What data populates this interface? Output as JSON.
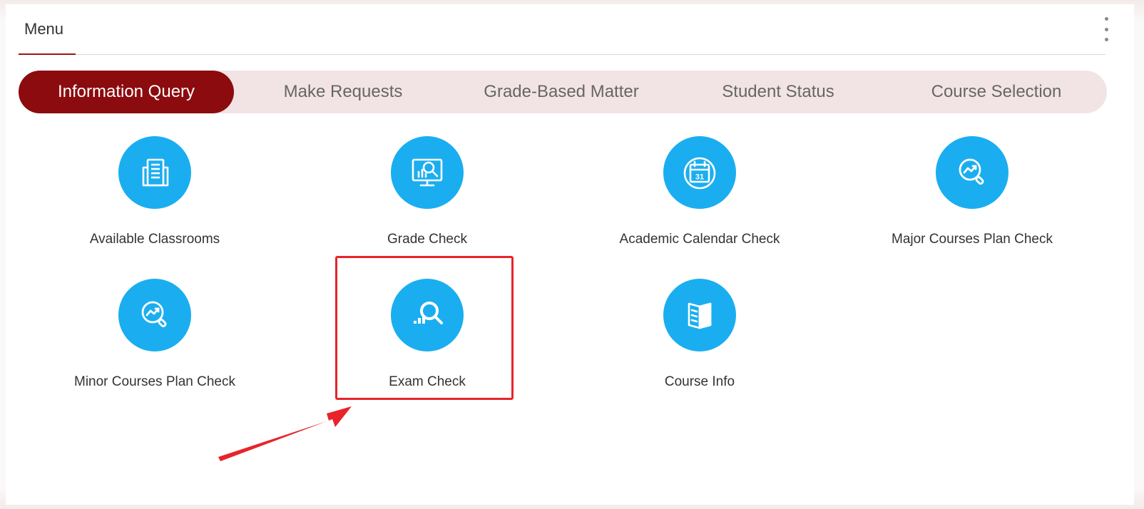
{
  "header": {
    "title": "Menu",
    "more_icon": "more-vertical-icon"
  },
  "tabs": [
    {
      "label": "Information Query",
      "active": true
    },
    {
      "label": "Make Requests",
      "active": false
    },
    {
      "label": "Grade-Based Matter",
      "active": false
    },
    {
      "label": "Student Status",
      "active": false
    },
    {
      "label": "Course Selection",
      "active": false
    }
  ],
  "tiles": [
    {
      "label": "Available Classrooms",
      "icon": "building-icon"
    },
    {
      "label": "Grade Check",
      "icon": "monitor-search-icon"
    },
    {
      "label": "Academic Calendar Check",
      "icon": "calendar-icon"
    },
    {
      "label": "Major Courses Plan Check",
      "icon": "trend-search-icon"
    },
    {
      "label": "Minor Courses Plan Check",
      "icon": "trend-search-icon"
    },
    {
      "label": "Exam Check",
      "icon": "chart-search-icon"
    },
    {
      "label": "Course Info",
      "icon": "book-icon"
    }
  ],
  "calendar_day": "31",
  "colors": {
    "accent": "#8c0b0e",
    "tab_bg": "#f2e4e5",
    "icon_bg": "#1aaef0",
    "annotation": "#e8232a"
  }
}
